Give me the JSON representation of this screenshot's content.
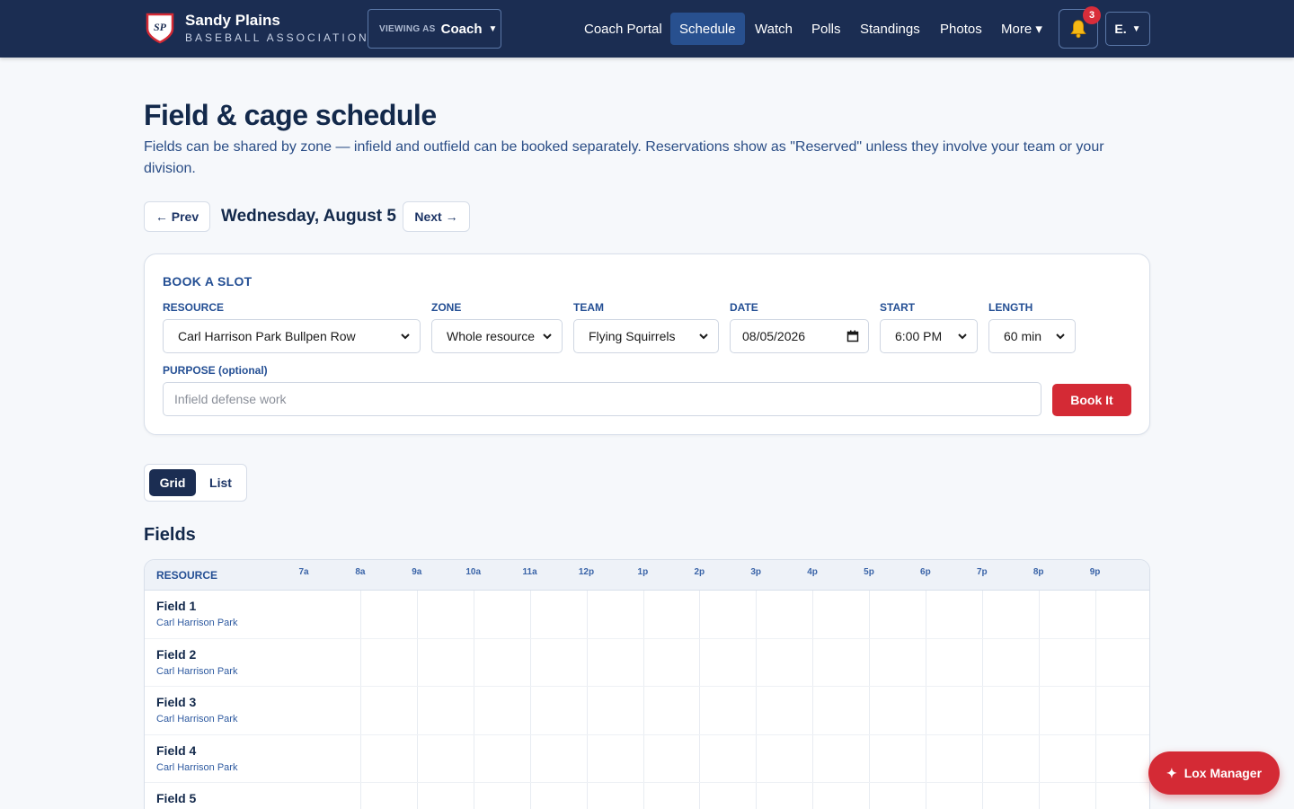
{
  "header": {
    "logo_text": "SP",
    "brand_name": "Sandy Plains",
    "brand_sub": "BASEBALL ASSOCIATION",
    "viewing_label": "VIEWING AS",
    "viewing_role": "Coach",
    "nav": [
      "Coach Portal",
      "Schedule",
      "Watch",
      "Polls",
      "Standings",
      "Photos",
      "More ▾"
    ],
    "active_nav": "Schedule",
    "notification_count": "3",
    "user_initial": "E."
  },
  "page": {
    "title": "Field & cage schedule",
    "description": "Fields can be shared by zone — infield and outfield can be booked separately. Reservations show as \"Reserved\" unless they involve your team or your division.",
    "prev_label": "← Prev",
    "current_date": "Wednesday, August 5",
    "next_label": "Next →"
  },
  "booking": {
    "title": "BOOK A SLOT",
    "resource_label": "RESOURCE",
    "resource_value": "Carl Harrison Park Bullpen Row",
    "zone_label": "ZONE",
    "zone_value": "Whole resource",
    "team_label": "TEAM",
    "team_value": "Flying Squirrels",
    "date_label": "DATE",
    "date_value": "08/05/2026",
    "start_label": "START",
    "start_value": "6:00 PM",
    "length_label": "LENGTH",
    "length_value": "60 min",
    "purpose_label": "PURPOSE (optional)",
    "purpose_placeholder": "Infield defense work",
    "book_label": "Book It"
  },
  "view_toggle": {
    "grid": "Grid",
    "list": "List",
    "active": "Grid"
  },
  "fields_section": {
    "title": "Fields",
    "resource_header": "RESOURCE",
    "hours": [
      "7a",
      "8a",
      "9a",
      "10a",
      "11a",
      "12p",
      "1p",
      "2p",
      "3p",
      "4p",
      "5p",
      "6p",
      "7p",
      "8p",
      "9p"
    ],
    "rows": [
      {
        "name": "Field 1",
        "location": "Carl Harrison Park"
      },
      {
        "name": "Field 2",
        "location": "Carl Harrison Park"
      },
      {
        "name": "Field 3",
        "location": "Carl Harrison Park"
      },
      {
        "name": "Field 4",
        "location": "Carl Harrison Park"
      },
      {
        "name": "Field 5",
        "location": ""
      }
    ]
  },
  "assistant_button": "Lox Manager",
  "colors": {
    "navy": "#1b2d52",
    "accent_red": "#d42a35",
    "link_blue": "#244f94"
  }
}
